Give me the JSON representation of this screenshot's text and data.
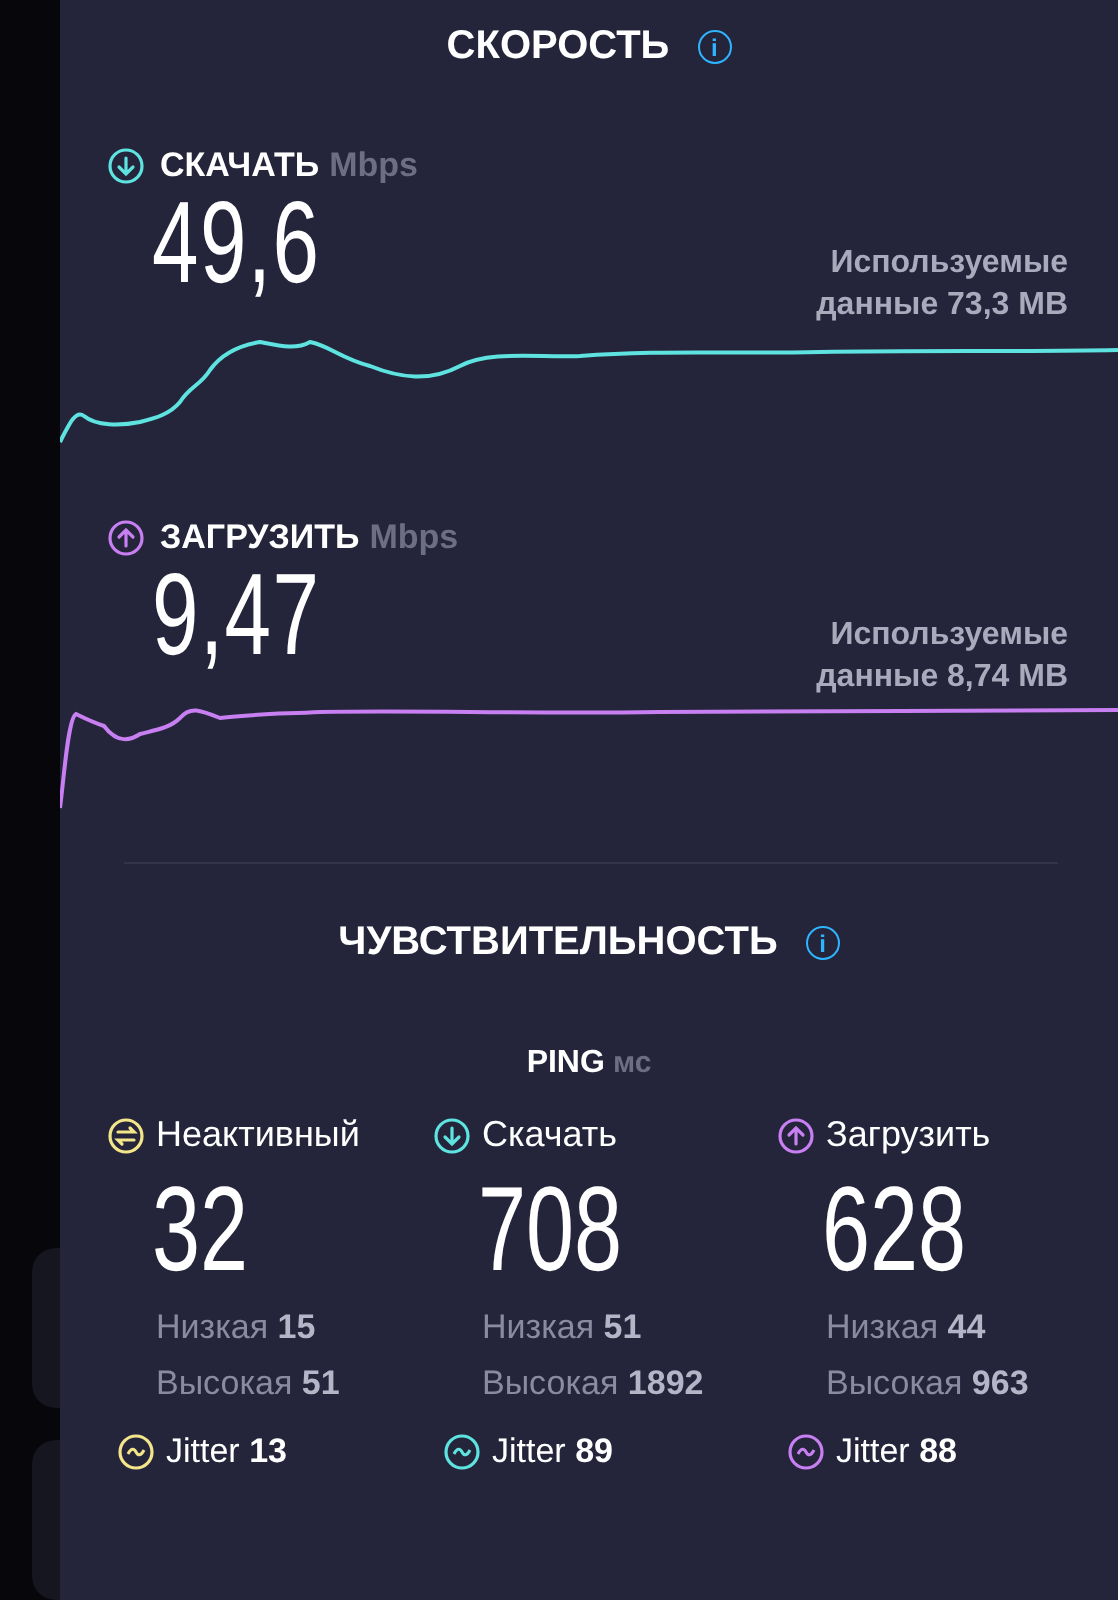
{
  "speed": {
    "title": "СКОРОСТЬ",
    "info": "i",
    "tests": [
      {
        "kind": "download",
        "color": "#5ee3e0",
        "label": "СКАЧАТЬ",
        "unit": "Mbps",
        "value": "49,6",
        "data_used": "Используемые данные 73,3 MB"
      },
      {
        "kind": "upload",
        "color": "#c77ff2",
        "label": "ЗАГРУЗИТЬ",
        "unit": "Mbps",
        "value": "9,47",
        "data_used": "Используемые данные 8,74 MB"
      }
    ]
  },
  "sensitivity": {
    "title": "ЧУВСТВИТЕЛЬНОСТЬ",
    "info": "i",
    "ping_label": "PING",
    "ping_unit": "мс",
    "columns": [
      {
        "kind": "idle",
        "color": "#f2e58a",
        "label": "Неактивный",
        "value": "32",
        "low": "Низкая **15**",
        "high": "Высокая **51**",
        "jitter": "Jitter **13**"
      },
      {
        "kind": "download",
        "color": "#5ee3e0",
        "label": "Скачать",
        "value": "708",
        "low": "Низкая **51**",
        "high": "Высокая **1892**",
        "jitter": "Jitter **89**"
      },
      {
        "kind": "upload",
        "color": "#c77ff2",
        "label": "Загрузить",
        "value": "628",
        "low": "Низкая **44**",
        "high": "Высокая **963**",
        "jitter": "Jitter **88**"
      }
    ]
  }
}
